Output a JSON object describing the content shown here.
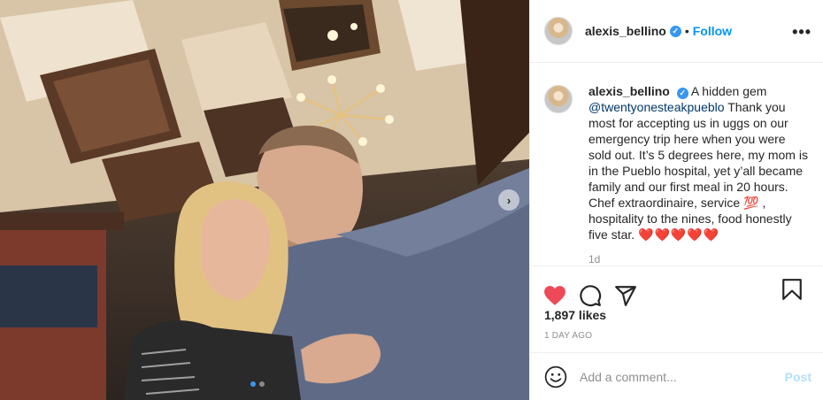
{
  "post": {
    "username": "alexis_bellino",
    "verified_mark": "✓",
    "separator": "•",
    "follow_label": "Follow",
    "more_label": "•••",
    "carousel_next": "›",
    "caption": {
      "username": "alexis_bellino",
      "text_before_mention": "A hidden gem",
      "mention": "@twentyonesteakpueblo",
      "text_after_mention": "Thank you most for accepting us in uggs on our emergency trip here when you were sold out. It’s 5 degrees here, my mom is in the Pueblo hospital, yet y’all became family and our first meal in 20 hours. Chef extraordinaire, service 💯 , hospitality to the nines, food honestly five star.",
      "hearts": "❤️❤️❤️❤️❤️",
      "time_ago": "1d"
    },
    "likes": "1,897 likes",
    "date": "1 DAY AGO",
    "comment_placeholder": "Add a comment...",
    "post_label": "Post",
    "colors": {
      "like_active": "#ed4956",
      "link": "#0095f6",
      "post_disabled": "#b2dffc"
    },
    "icons": [
      "heart-icon",
      "comment-icon",
      "share-icon",
      "bookmark-icon",
      "emoji-icon",
      "verified-icon",
      "more-icon",
      "chevron-right-icon"
    ]
  }
}
